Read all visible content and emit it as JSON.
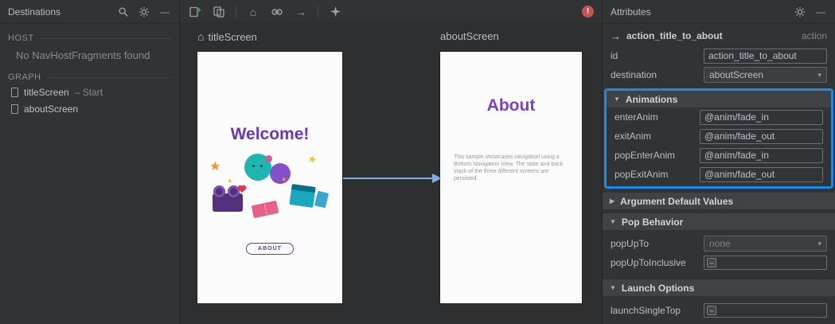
{
  "destinations": {
    "title": "Destinations",
    "host_label": "HOST",
    "host_empty": "No NavHostFragments found",
    "graph_label": "GRAPH",
    "items": [
      {
        "label": "titleScreen",
        "suffix": "– Start"
      },
      {
        "label": "aboutScreen",
        "suffix": ""
      }
    ]
  },
  "canvas": {
    "title_screen": {
      "label": "titleScreen",
      "heading": "Welcome!",
      "button": "ABOUT"
    },
    "about_screen": {
      "label": "aboutScreen",
      "heading": "About",
      "body": "This sample showcases navigation using a Bottom Navigation View. The state and back stack of the three different screens are persisted."
    }
  },
  "attributes": {
    "title": "Attributes",
    "action": {
      "name": "action_title_to_about",
      "type": "action"
    },
    "id": {
      "label": "id",
      "value": "action_title_to_about"
    },
    "destination": {
      "label": "destination",
      "value": "aboutScreen"
    },
    "animations": {
      "header": "Animations",
      "rows": [
        {
          "label": "enterAnim",
          "value": "@anim/fade_in"
        },
        {
          "label": "exitAnim",
          "value": "@anim/fade_out"
        },
        {
          "label": "popEnterAnim",
          "value": "@anim/fade_in"
        },
        {
          "label": "popExitAnim",
          "value": "@anim/fade_out"
        }
      ]
    },
    "argument_defaults": {
      "header": "Argument Default Values"
    },
    "pop_behavior": {
      "header": "Pop Behavior",
      "pop_up_to": {
        "label": "popUpTo",
        "value": "none"
      },
      "pop_up_to_inclusive": {
        "label": "popUpToInclusive"
      }
    },
    "launch_options": {
      "header": "Launch Options",
      "launch_single_top": {
        "label": "launchSingleTop"
      }
    }
  },
  "icons": {
    "minimize": "—",
    "home": "⌂",
    "arrow_right": "→",
    "caret": "▾",
    "expanded": "▼",
    "collapsed": "▶",
    "indeterminate": "–",
    "error": "!",
    "star": "★"
  },
  "colors": {
    "accent_blue": "#1e88e5",
    "purple": "#6639b6",
    "arrow_blue": "#7daee8",
    "error_red": "#c75450"
  }
}
